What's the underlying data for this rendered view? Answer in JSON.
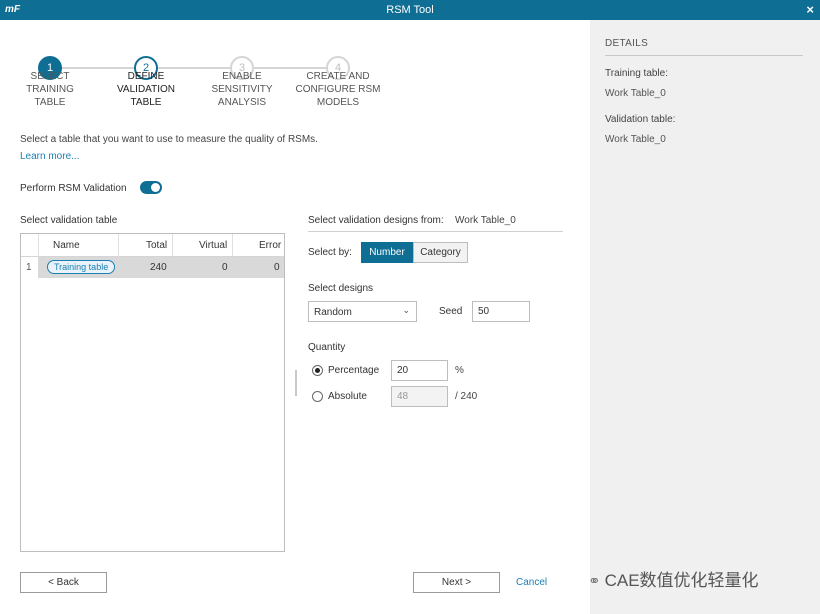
{
  "window": {
    "logo": "mF",
    "title": "RSM Tool",
    "close": "×"
  },
  "steps": [
    {
      "num": "1",
      "line1": "SELECT",
      "line2": "TRAINING",
      "line3": "TABLE"
    },
    {
      "num": "2",
      "line1": "DEFINE",
      "line2": "VALIDATION",
      "line3": "TABLE"
    },
    {
      "num": "3",
      "line1": "ENABLE",
      "line2": "SENSITIVITY",
      "line3": "ANALYSIS"
    },
    {
      "num": "4",
      "line1": "CREATE AND",
      "line2": "CONFIGURE RSM",
      "line3": "MODELS"
    }
  ],
  "intro": "Select a table that you want to use to measure the quality of RSMs.",
  "learn_more": "Learn more...",
  "perform_validation": {
    "label": "Perform RSM Validation",
    "enabled": true
  },
  "table_section": {
    "label": "Select validation table",
    "columns": [
      "Name",
      "Total",
      "Virtual",
      "Error"
    ],
    "rows": [
      {
        "num": "1",
        "name": "Training table",
        "total": "240",
        "virtual": "0",
        "error": "0"
      }
    ]
  },
  "validation": {
    "from_label": "Select validation designs from:",
    "from_value": "Work Table_0",
    "select_by_label": "Select by:",
    "select_by_options": [
      "Number",
      "Category"
    ],
    "select_by_selected": "Number",
    "select_designs_label": "Select designs",
    "designs_value": "Random",
    "seed_label": "Seed",
    "seed_value": "50",
    "quantity_label": "Quantity",
    "percentage_label": "Percentage",
    "percentage_value": "20",
    "percentage_unit": "%",
    "absolute_label": "Absolute",
    "absolute_value": "48",
    "absolute_suffix": "/ 240"
  },
  "footer": {
    "back": "< Back",
    "next": "Next >",
    "cancel": "Cancel"
  },
  "details": {
    "header": "DETAILS",
    "training_label": "Training table:",
    "training_value": "Work Table_0",
    "validation_label": "Validation table:",
    "validation_value": "Work Table_0"
  },
  "watermark": "CAE数值优化轻量化",
  "colors": {
    "accent": "#0f6e93",
    "link": "#1a7fb3"
  }
}
